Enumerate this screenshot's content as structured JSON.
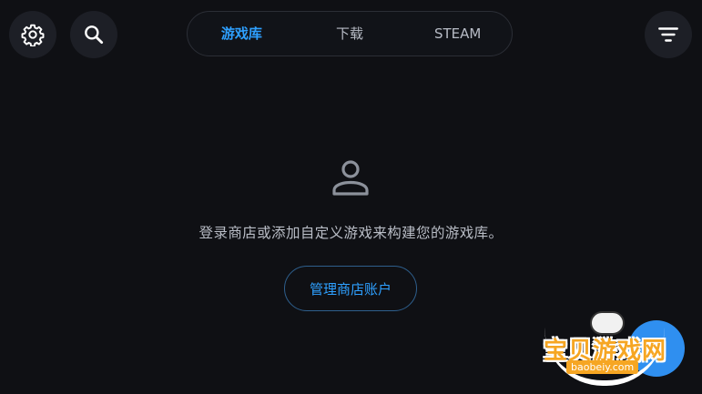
{
  "toolbar": {
    "settings_icon": "gear-icon",
    "search_icon": "search-icon",
    "filter_icon": "filter-icon"
  },
  "tabs": [
    {
      "label": "游戏库",
      "active": true
    },
    {
      "label": "下载",
      "active": false
    },
    {
      "label": "STEAM",
      "active": false
    }
  ],
  "empty_state": {
    "icon": "user-icon",
    "message": "登录商店或添加自定义游戏来构建您的游戏库。",
    "manage_button": "管理商店账户"
  },
  "watermark": {
    "title": "宝贝游戏网",
    "subtitle": "baobeiy.com"
  },
  "colors": {
    "background": "#0f1014",
    "accent": "#2ea0ff",
    "button_bg": "#1d1f26"
  }
}
